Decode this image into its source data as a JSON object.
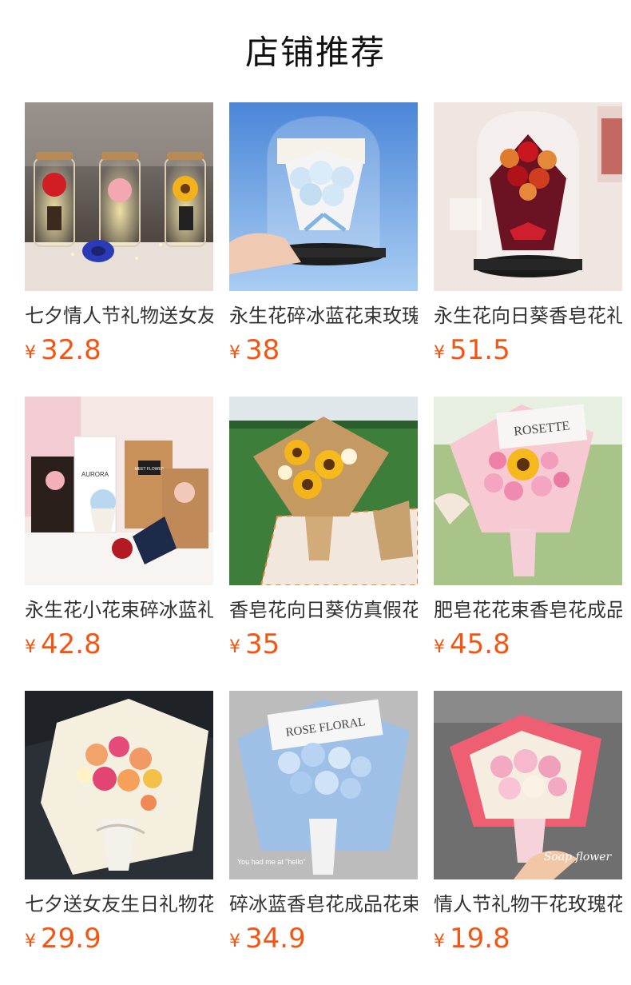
{
  "section": {
    "title": "店铺推荐"
  },
  "products": [
    {
      "name": "七夕情人节礼物送女友生日",
      "currency": "¥",
      "price": "32.8",
      "image": "flower-jars-image"
    },
    {
      "name": "永生花碎冰蓝花束玫瑰礼盒",
      "currency": "¥",
      "price": "38",
      "image": "blue-dome-bouquet-image"
    },
    {
      "name": "永生花向日葵香皂花礼盒",
      "currency": "¥",
      "price": "51.5",
      "image": "red-dome-bouquet-image"
    },
    {
      "name": "永生花小花束碎冰蓝礼盒",
      "currency": "¥",
      "price": "42.8",
      "image": "gift-box-bouquets-image"
    },
    {
      "name": "香皂花向日葵仿真假花束",
      "currency": "¥",
      "price": "35",
      "image": "sunflower-kraft-bouquet-image"
    },
    {
      "name": "肥皂花花束香皂花成品",
      "currency": "¥",
      "price": "45.8",
      "image": "pink-sunflower-bouquet-image"
    },
    {
      "name": "七夕送女友生日礼物花束",
      "currency": "¥",
      "price": "29.9",
      "image": "cream-rose-bouquet-image"
    },
    {
      "name": "碎冰蓝香皂花成品花束礼",
      "currency": "¥",
      "price": "34.9",
      "image": "blue-rose-bouquet-image"
    },
    {
      "name": "情人节礼物干花玫瑰花束",
      "currency": "¥",
      "price": "19.8",
      "image": "pink-soap-flower-bouquet-image"
    }
  ],
  "image_texts": {
    "wrap_logo_1": "ROSETTE",
    "wrap_logo_2": "ROSE FLORAL",
    "caption_hello": "You had me at \"hello\"",
    "caption_soap": "Soap flower",
    "box_label_1": "AURORA",
    "box_label_2": "MEET FLOWER"
  },
  "colors": {
    "price": "#f25614",
    "title": "#111111",
    "name": "#333333"
  }
}
